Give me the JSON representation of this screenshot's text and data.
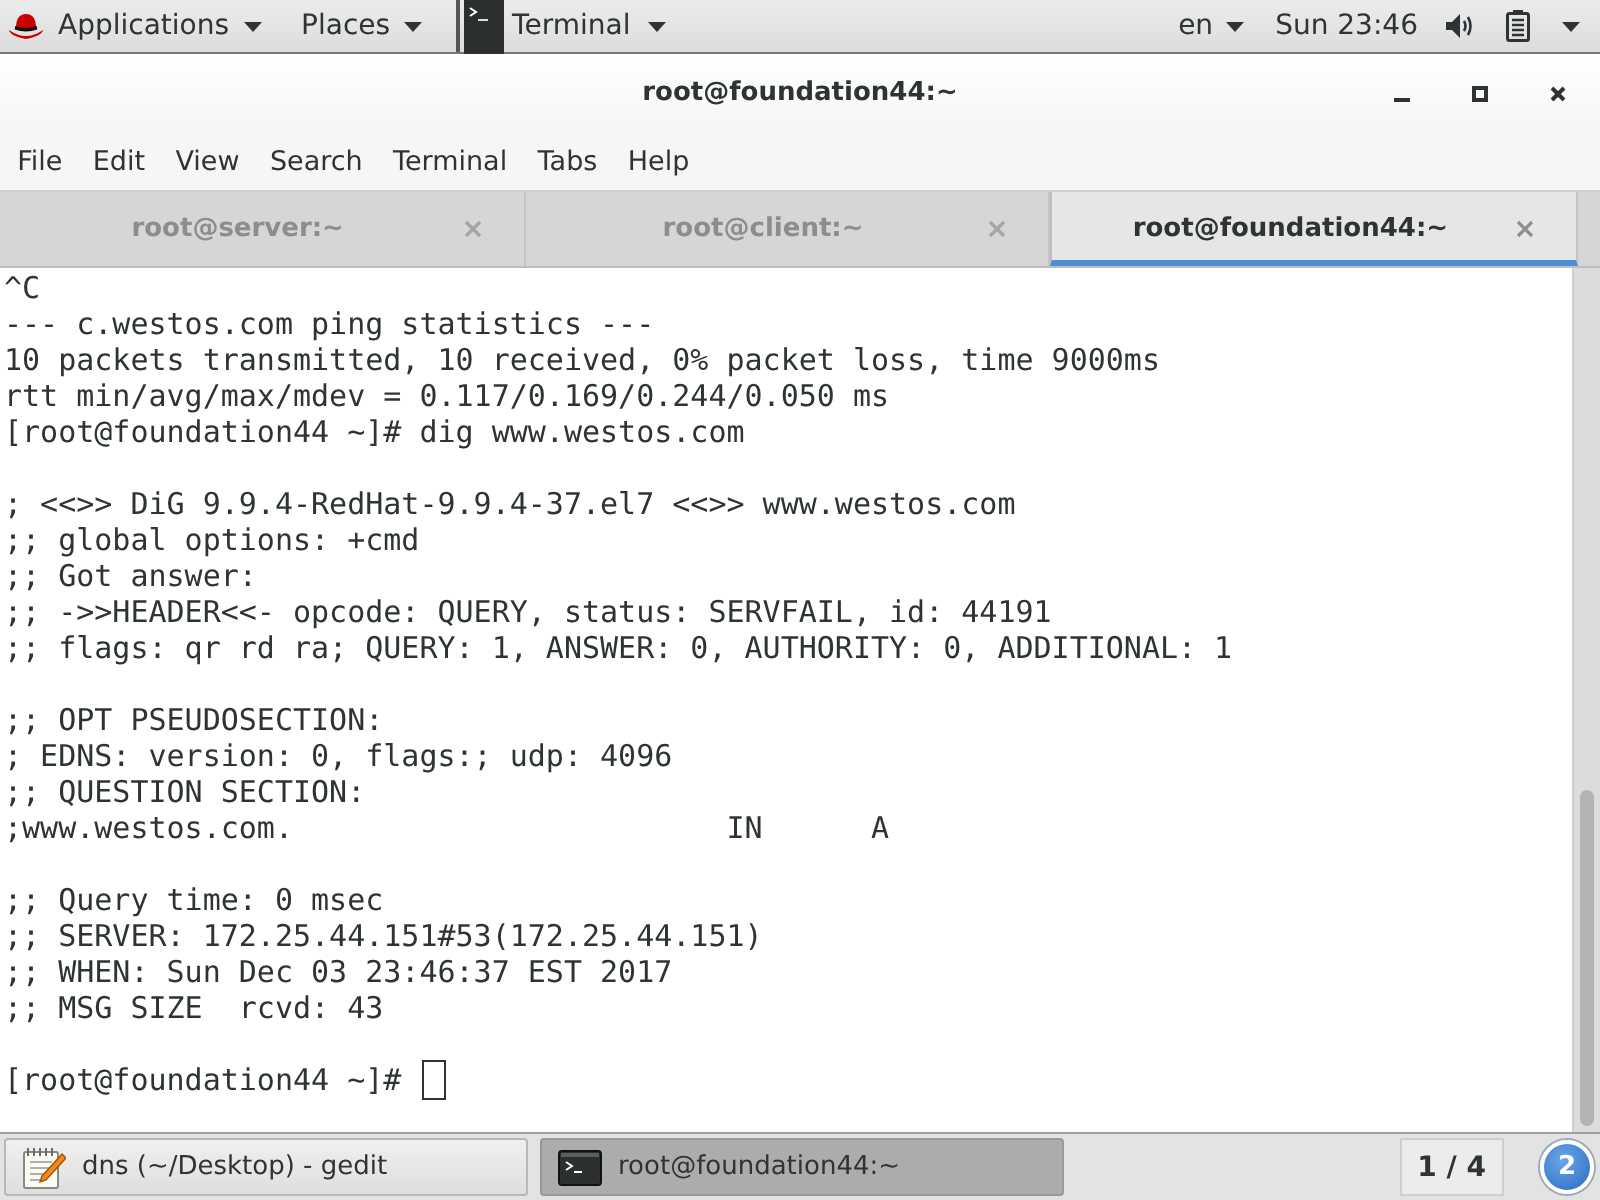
{
  "top_bar": {
    "menus": [
      {
        "label": "Applications",
        "kind": "applications"
      },
      {
        "label": "Places",
        "kind": "plain"
      }
    ],
    "app_menu": {
      "label": "Terminal"
    },
    "keyboard_layout": "en",
    "clock": "Sun 23:46"
  },
  "window": {
    "title": "root@foundation44:~"
  },
  "menu_bar": [
    "File",
    "Edit",
    "View",
    "Search",
    "Terminal",
    "Tabs",
    "Help"
  ],
  "tabs": [
    {
      "label": "root@server:~",
      "selected": false
    },
    {
      "label": "root@client:~",
      "selected": false
    },
    {
      "label": "root@foundation44:~",
      "selected": true
    }
  ],
  "terminal": {
    "blocks": [
      [
        "^C",
        "--- c.westos.com ping statistics ---",
        "10 packets transmitted, 10 received, 0% packet loss, time 9000ms",
        "rtt min/avg/max/mdev = 0.117/0.169/0.244/0.050 ms",
        "[root@foundation44 ~]# dig www.westos.com"
      ],
      [
        "; <<>> DiG 9.9.4-RedHat-9.9.4-37.el7 <<>> www.westos.com",
        ";; global options: +cmd",
        ";; Got answer:",
        ";; ->>HEADER<<- opcode: QUERY, status: SERVFAIL, id: 44191",
        ";; flags: qr rd ra; QUERY: 1, ANSWER: 0, AUTHORITY: 0, ADDITIONAL: 1"
      ],
      [
        ";; OPT PSEUDOSECTION:",
        "; EDNS: version: 0, flags:; udp: 4096",
        ";; QUESTION SECTION:",
        ";www.westos.com.                        IN      A"
      ],
      [
        ";; Query time: 0 msec",
        ";; SERVER: 172.25.44.151#53(172.25.44.151)",
        ";; WHEN: Sun Dec 03 23:46:37 EST 2017",
        ";; MSG SIZE  rcvd: 43"
      ]
    ],
    "prompt": "[root@foundation44 ~]#",
    "cursor": true
  },
  "taskbar": {
    "windows": [
      {
        "label": "dns (~/Desktop) - gedit",
        "kind": "editor",
        "selected": false
      },
      {
        "label": "root@foundation44:~",
        "kind": "terminal",
        "selected": true
      }
    ],
    "workspace": "1 / 4",
    "message_count": "2"
  }
}
